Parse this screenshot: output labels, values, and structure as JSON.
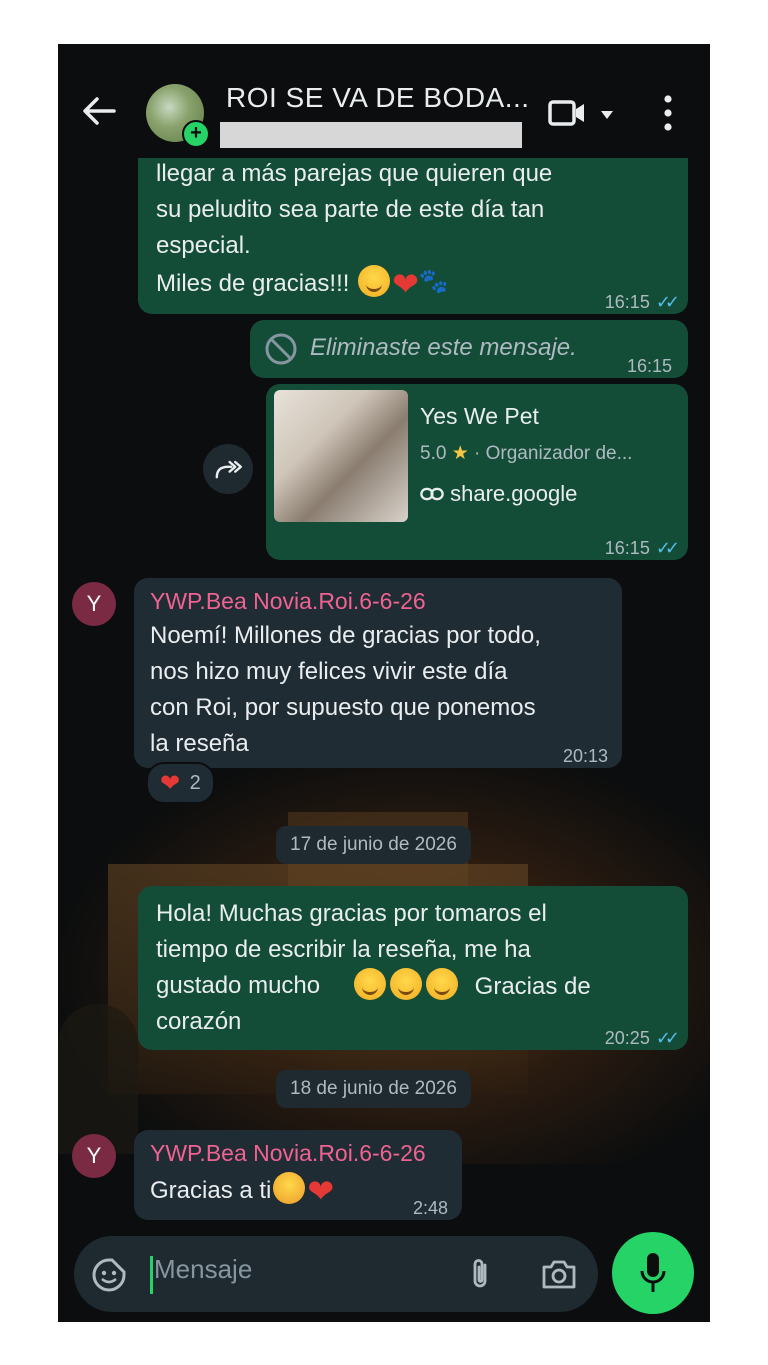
{
  "header": {
    "title": "ROI SE VA DE BODA...",
    "icons": [
      "back-arrow-icon",
      "video-call-icon",
      "chevron-down-icon",
      "more-vert-icon"
    ]
  },
  "messages": {
    "m1": {
      "lines": "llegar a más parejas que quieren que\nsu peludito sea parte de este día tan\nespecial.",
      "last_line": "Miles de gracias!!!",
      "time": "16:15"
    },
    "deleted": {
      "text": "Eliminaste este mensaje.",
      "time": "16:15"
    },
    "link": {
      "title": "Yes We Pet",
      "rating": "5.0",
      "category": "· Organizador de...",
      "url": "share.google",
      "time": "16:15"
    },
    "m3": {
      "sender": "YWP.Bea Novia.Roi.6-6-26",
      "avatar_letter": "Y",
      "text": "Noemí! Millones de gracias por todo,\nnos hizo muy felices vivir este día\ncon Roi, por supuesto que ponemos\nla reseña",
      "time": "20:13",
      "reaction_count": "2"
    },
    "date1": "17 de junio de 2026",
    "m4": {
      "text_a": "Hola! Muchas gracias por tomaros el\ntiempo de escribir la reseña, me ha\ngustado mucho",
      "text_b": "Gracias de",
      "text_c": "corazón",
      "time": "20:25"
    },
    "date2": "18 de junio de 2026",
    "m5": {
      "sender": "YWP.Bea Novia.Roi.6-6-26",
      "avatar_letter": "Y",
      "text": "Gracias a ti",
      "time": "2:48"
    }
  },
  "composer": {
    "placeholder": "Mensaje"
  },
  "colors": {
    "outgoing_bubble": "#144d37",
    "incoming_bubble": "#202c33",
    "accent_green": "#25d366",
    "sender_name": "#f06292",
    "read_ticks": "#53bdeb"
  }
}
